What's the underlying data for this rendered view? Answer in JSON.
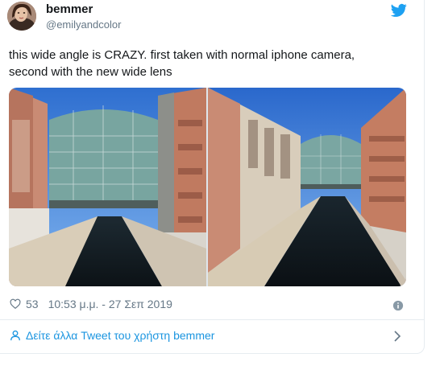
{
  "tweet": {
    "display_name": "bemmer",
    "handle": "@emilyandcolor",
    "text_line1": "this wide angle is CRAZY. first taken with normal iphone camera,",
    "text_line2": "second with the new wide lens",
    "likes": "53",
    "timestamp": "10:53 μ.μ. - 27 Σεπ 2019",
    "more_tweets_label": "Δείτε άλλα Tweet του χρήστη bemmer"
  },
  "icons": {
    "brand": "twitter-bird-icon",
    "like": "heart-icon",
    "info": "info-icon",
    "profile": "user-icon",
    "chevron": "chevron-right-icon"
  },
  "colors": {
    "twitter_blue": "#1da1f2",
    "link_blue": "#1b95e0",
    "muted_text": "#657786",
    "border": "#e6ecf0",
    "text": "#14171a"
  }
}
